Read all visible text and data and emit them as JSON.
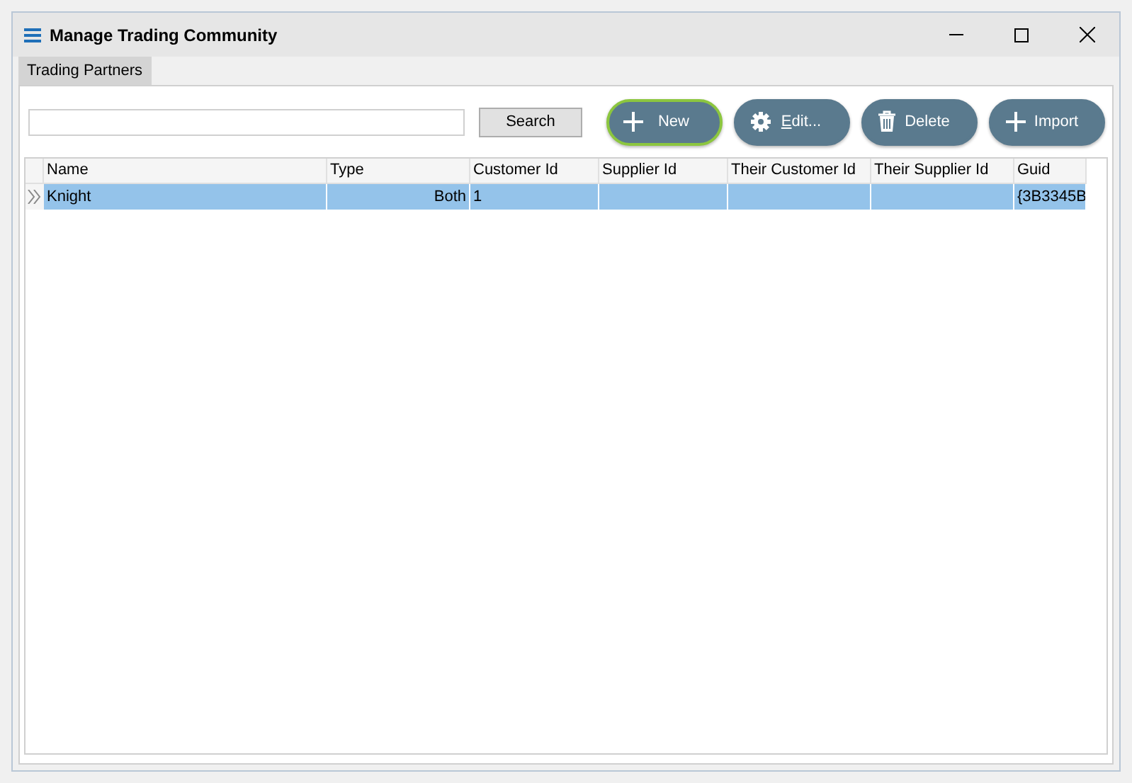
{
  "window": {
    "title": "Manage Trading Community"
  },
  "tabs": [
    {
      "label": "Trading Partners",
      "selected": true
    }
  ],
  "search": {
    "button": "Search"
  },
  "actions": [
    {
      "kind": "add",
      "label": "New",
      "focused": true
    },
    {
      "kind": "settings",
      "label": "Edit...",
      "focused": false
    },
    {
      "kind": "delete",
      "label": "Delete",
      "focused": false
    },
    {
      "kind": "add",
      "label": "Import",
      "focused": false
    }
  ],
  "table": {
    "columns": [
      "Name",
      "Type",
      "Customer Id",
      "Supplier Id",
      "Their Customer Id",
      "Their Supplier Id",
      "Guid"
    ],
    "rows": [
      {
        "selected": true,
        "cells": [
          "Knight",
          "Both",
          "1",
          "",
          "",
          "",
          "{3B3345B"
        ]
      }
    ]
  }
}
